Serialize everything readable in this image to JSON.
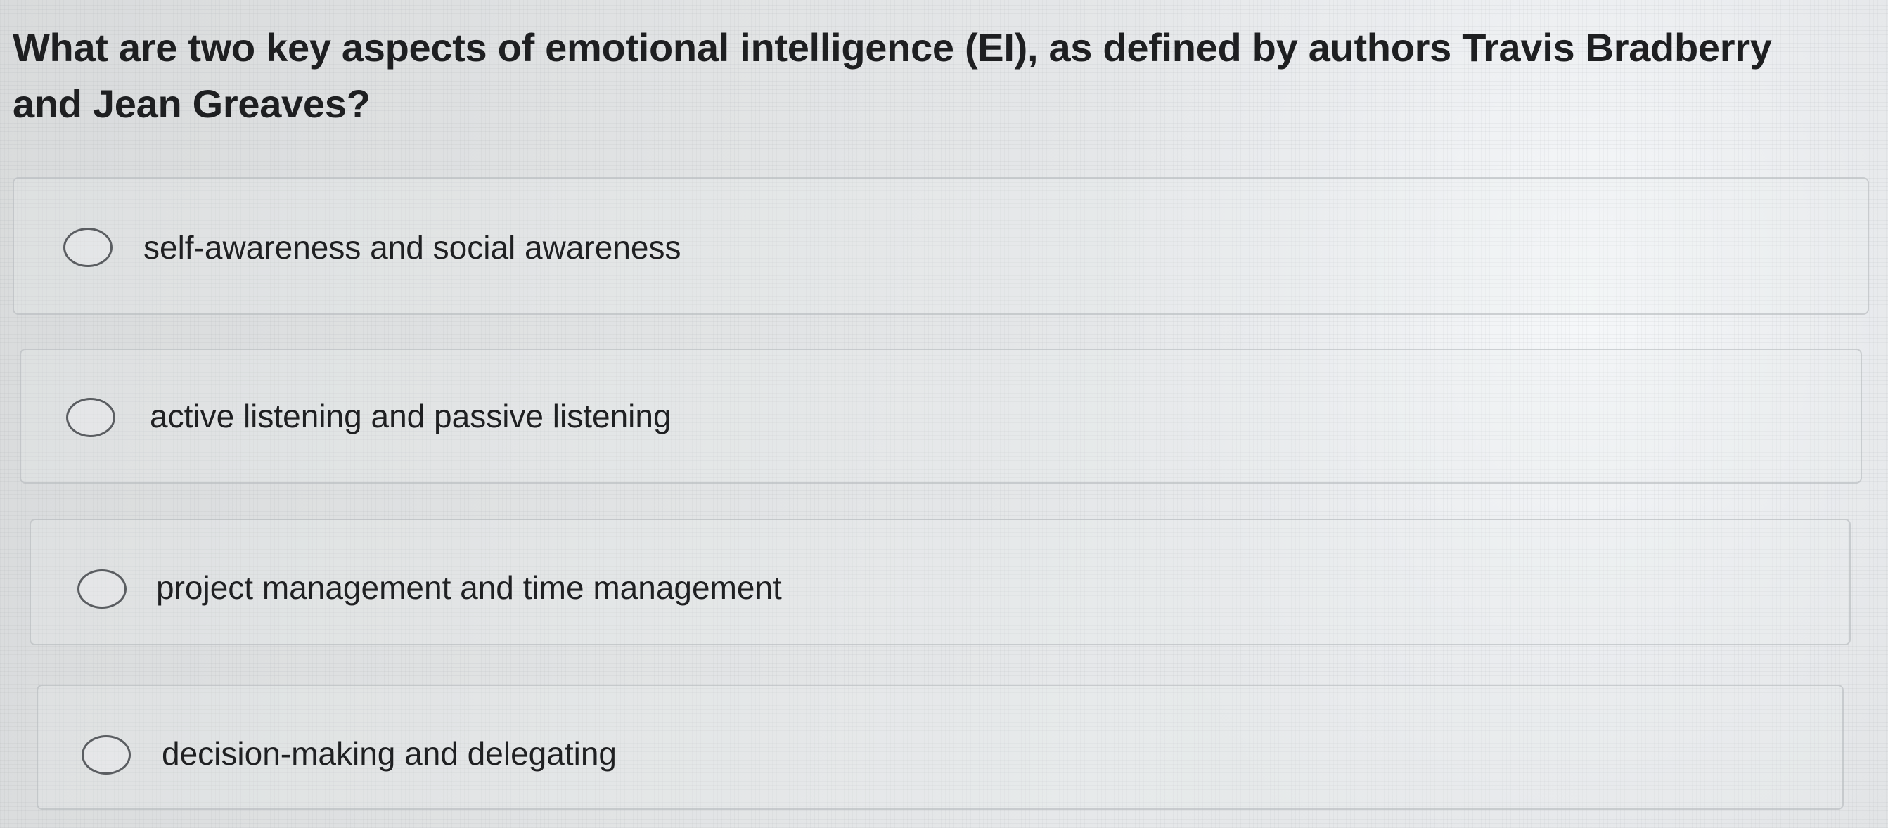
{
  "question": {
    "text": "What are two key aspects of emotional intelligence (EI), as defined by authors Travis Bradberry and Jean Greaves?"
  },
  "options": [
    {
      "label": "self-awareness and social awareness",
      "selected": false,
      "icon": "radio-unchecked-icon"
    },
    {
      "label": "active listening and passive listening",
      "selected": false,
      "icon": "radio-unchecked-icon"
    },
    {
      "label": "project management and time management",
      "selected": false,
      "icon": "radio-unchecked-icon"
    },
    {
      "label": "decision-making and delegating",
      "selected": false,
      "icon": "radio-unchecked-icon"
    }
  ],
  "colors": {
    "text": "#1e1f21",
    "radio_border": "#5a5d61",
    "option_border": "#afb2b6",
    "background": "#e1e3e4"
  }
}
